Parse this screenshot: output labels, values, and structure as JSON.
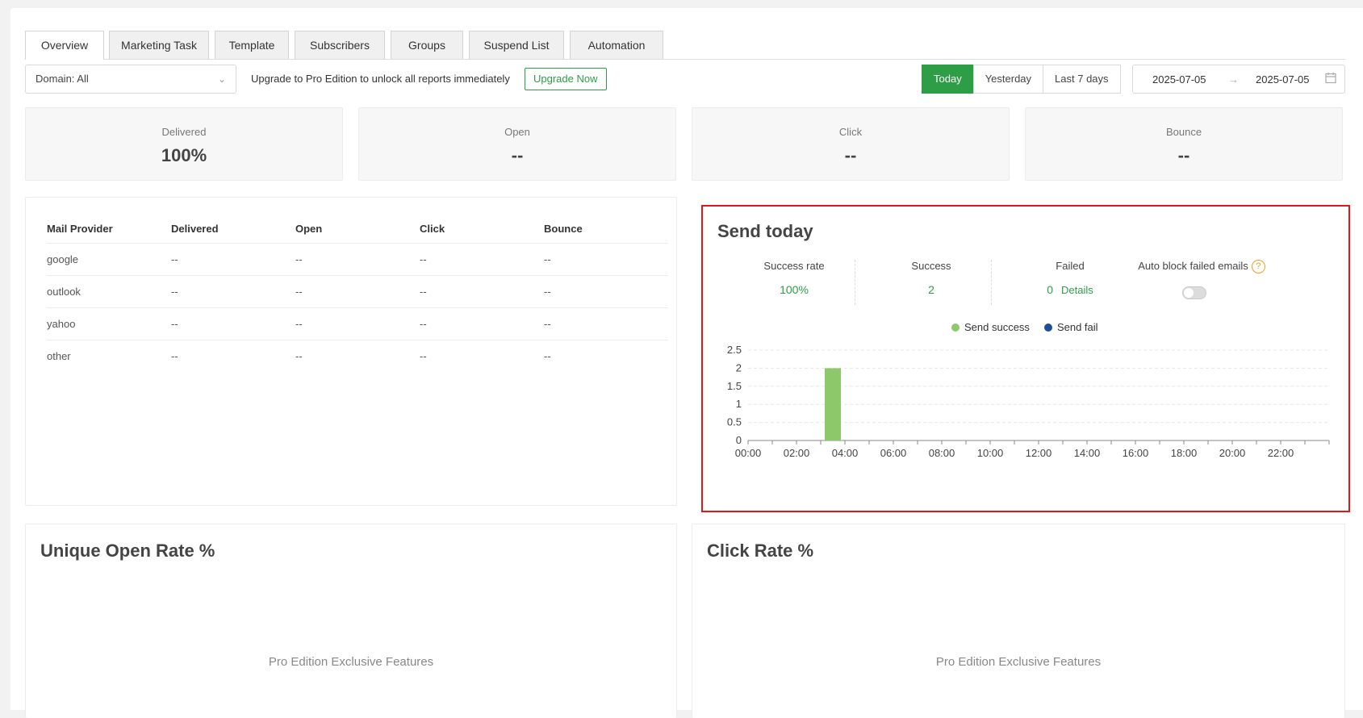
{
  "tabs": [
    "Overview",
    "Marketing Task",
    "Template",
    "Subscribers",
    "Groups",
    "Suspend List",
    "Automation"
  ],
  "toolbar": {
    "domain_select": "Domain: All",
    "upgrade_text": "Upgrade to Pro Edition to unlock all reports immediately",
    "upgrade_button": "Upgrade Now",
    "range_buttons": [
      "Today",
      "Yesterday",
      "Last 7 days"
    ],
    "active_range": "Today",
    "date_start": "2025-07-05",
    "date_end": "2025-07-05",
    "arrow_icon": "arrow-right-icon",
    "calendar_icon": "calendar-icon"
  },
  "stats": [
    {
      "label": "Delivered",
      "value": "100%"
    },
    {
      "label": "Open",
      "value": "--"
    },
    {
      "label": "Click",
      "value": "--"
    },
    {
      "label": "Bounce",
      "value": "--"
    }
  ],
  "provider_table": {
    "headers": [
      "Mail Provider",
      "Delivered",
      "Open",
      "Click",
      "Bounce"
    ],
    "rows": [
      [
        "google",
        "--",
        "--",
        "--",
        "--"
      ],
      [
        "outlook",
        "--",
        "--",
        "--",
        "--"
      ],
      [
        "yahoo",
        "--",
        "--",
        "--",
        "--"
      ],
      [
        "other",
        "--",
        "--",
        "--",
        "--"
      ]
    ]
  },
  "send_today": {
    "title": "Send today",
    "success_rate_label": "Success rate",
    "success_rate_value": "100%",
    "success_label": "Success",
    "success_value": "2",
    "failed_label": "Failed",
    "failed_value": "0",
    "details_link": "Details",
    "auto_block_label": "Auto block failed emails",
    "auto_block_enabled": false,
    "help_icon": "question-circle-icon"
  },
  "chart_data": {
    "type": "bar",
    "categories": [
      "00:00",
      "01:00",
      "02:00",
      "03:00",
      "04:00",
      "05:00",
      "06:00",
      "07:00",
      "08:00",
      "09:00",
      "10:00",
      "11:00",
      "12:00",
      "13:00",
      "14:00",
      "15:00",
      "16:00",
      "17:00",
      "18:00",
      "19:00",
      "20:00",
      "21:00",
      "22:00",
      "23:00"
    ],
    "tick_labels": [
      "00:00",
      "02:00",
      "04:00",
      "06:00",
      "08:00",
      "10:00",
      "12:00",
      "14:00",
      "16:00",
      "18:00",
      "20:00",
      "22:00"
    ],
    "series": [
      {
        "name": "Send success",
        "color": "#8dc96b",
        "values": [
          0,
          0,
          0,
          2,
          0,
          0,
          0,
          0,
          0,
          0,
          0,
          0,
          0,
          0,
          0,
          0,
          0,
          0,
          0,
          0,
          0,
          0,
          0,
          0
        ]
      },
      {
        "name": "Send fail",
        "color": "#1f4e9c",
        "values": [
          0,
          0,
          0,
          0,
          0,
          0,
          0,
          0,
          0,
          0,
          0,
          0,
          0,
          0,
          0,
          0,
          0,
          0,
          0,
          0,
          0,
          0,
          0,
          0
        ]
      }
    ],
    "ylim": [
      0,
      2.5
    ],
    "yticks": [
      "0",
      "0.5",
      "1",
      "1.5",
      "2",
      "2.5"
    ],
    "legend_position": "top-center",
    "grid": true
  },
  "bottom_panels": [
    {
      "title": "Unique Open Rate %",
      "message": "Pro Edition Exclusive Features"
    },
    {
      "title": "Click Rate %",
      "message": "Pro Edition Exclusive Features"
    }
  ]
}
